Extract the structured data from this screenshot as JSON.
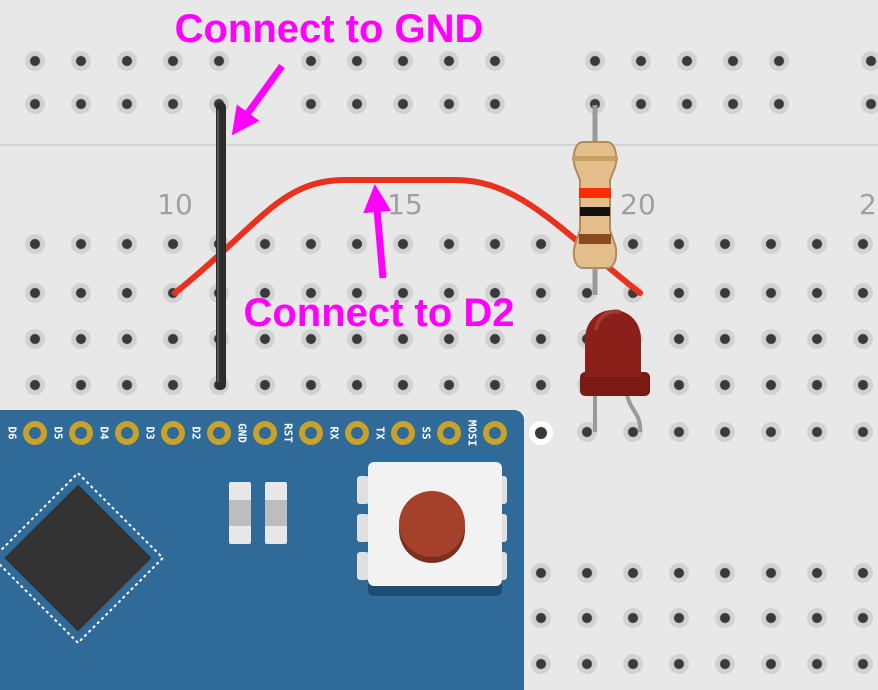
{
  "annotations": {
    "gnd": "Connect to GND",
    "d2": "Connect to D2"
  },
  "breadboard": {
    "row_numbers": [
      "10",
      "15",
      "20",
      "2"
    ]
  },
  "arduino": {
    "pins": [
      "D6",
      "D5",
      "D4",
      "D3",
      "D2",
      "GND",
      "RST",
      "RX",
      "TX",
      "SS",
      "MOSI"
    ]
  },
  "colors": {
    "breadboard": "#e8e8e8",
    "hole": "#3a3a3a",
    "board": "#2f6a99",
    "jumper_red": "#e8321e",
    "jumper_black": "#2c2c2c",
    "annotation": "#ff00ff",
    "led": "#8b1f1a",
    "resistor_body": "#e3be8a"
  }
}
